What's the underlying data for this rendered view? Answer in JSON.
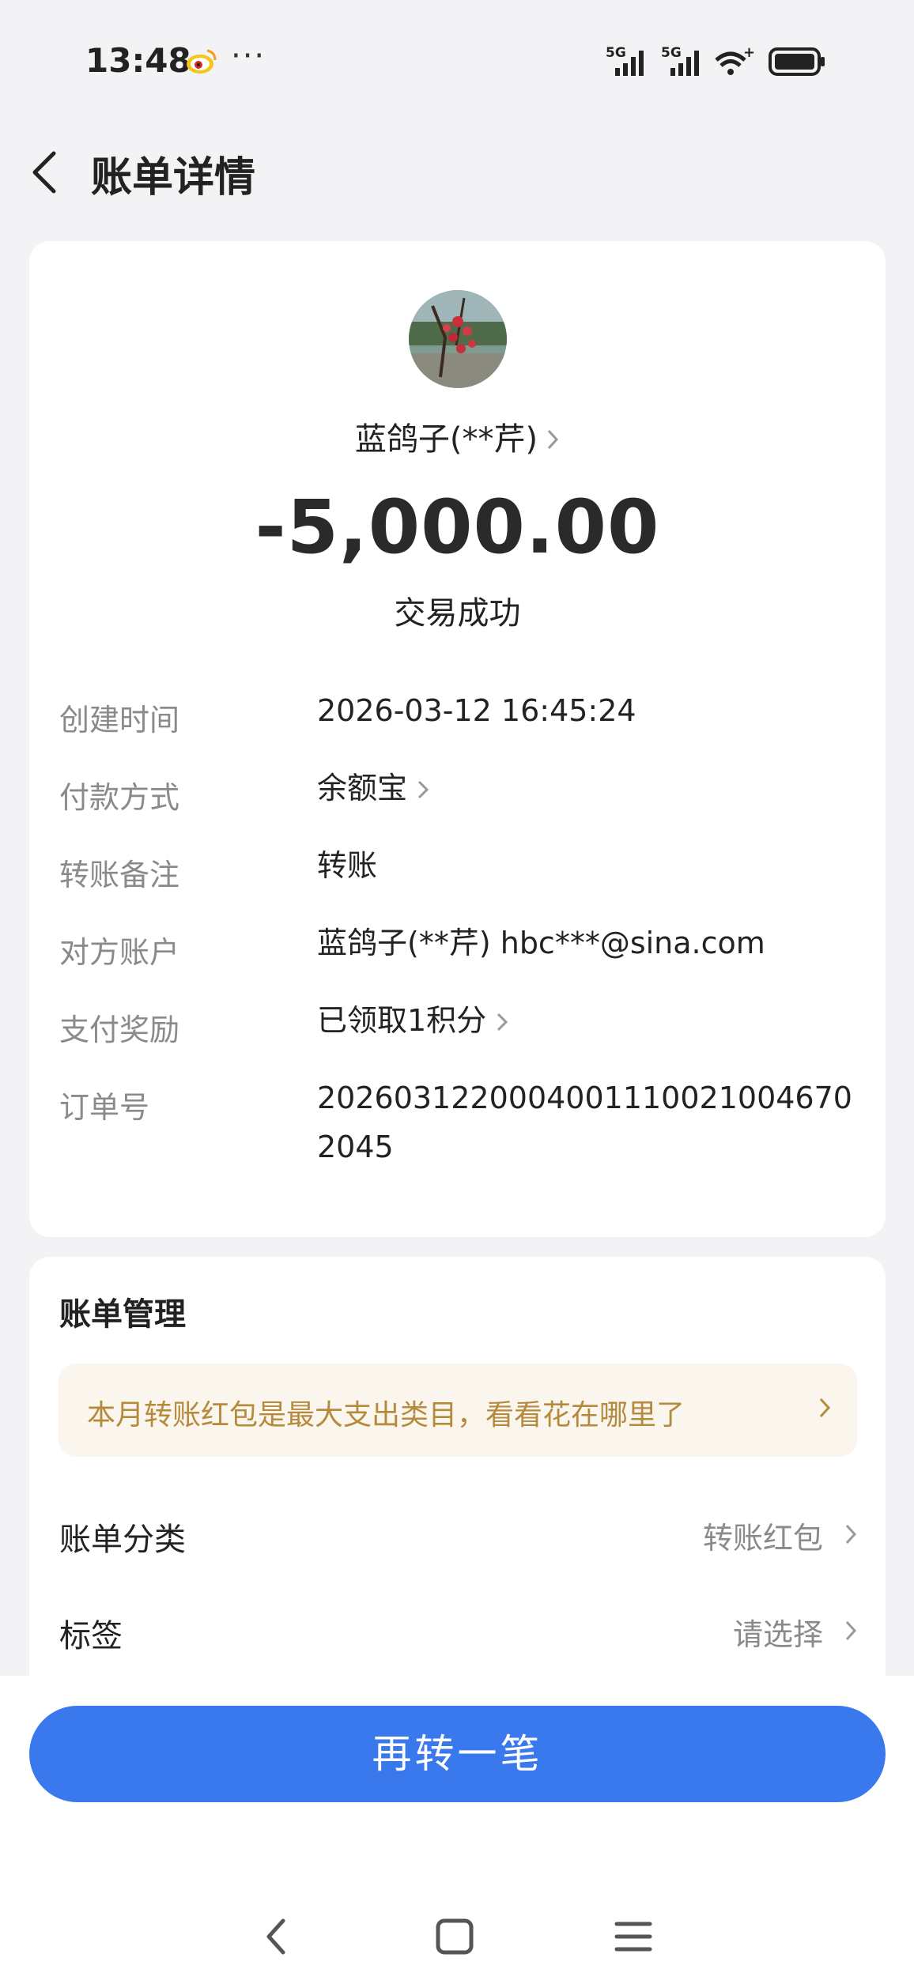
{
  "status_bar": {
    "time": "13:48",
    "more": "···"
  },
  "nav": {
    "title": "账单详情"
  },
  "transaction": {
    "payee": "蓝鸽子(**芹)",
    "amount": "-5,000.00",
    "status": "交易成功"
  },
  "details": [
    {
      "label": "创建时间",
      "value": "2026-03-12 16:45:24",
      "has_arrow": false
    },
    {
      "label": "付款方式",
      "value": "余额宝",
      "has_arrow": true
    },
    {
      "label": "转账备注",
      "value": "转账",
      "has_arrow": false
    },
    {
      "label": "对方账户",
      "value": "蓝鸽子(**芹) hbc***@sina.com",
      "has_arrow": false
    },
    {
      "label": "支付奖励",
      "value": "已领取1积分",
      "has_arrow": true
    },
    {
      "label": "订单号",
      "value": "20260312200040011100210046702045",
      "has_arrow": false
    }
  ],
  "management": {
    "title": "账单管理",
    "tip": "本月转账红包是最大支出类目，看看花在哪里了",
    "rows": [
      {
        "label": "账单分类",
        "value": "转账红包"
      },
      {
        "label": "标签",
        "value": "请选择"
      }
    ]
  },
  "actions": {
    "primary": "再转一笔"
  },
  "colors": {
    "primary": "#3a78ee",
    "tip_text": "#b58a3d",
    "tip_bg": "#faf6ee"
  }
}
